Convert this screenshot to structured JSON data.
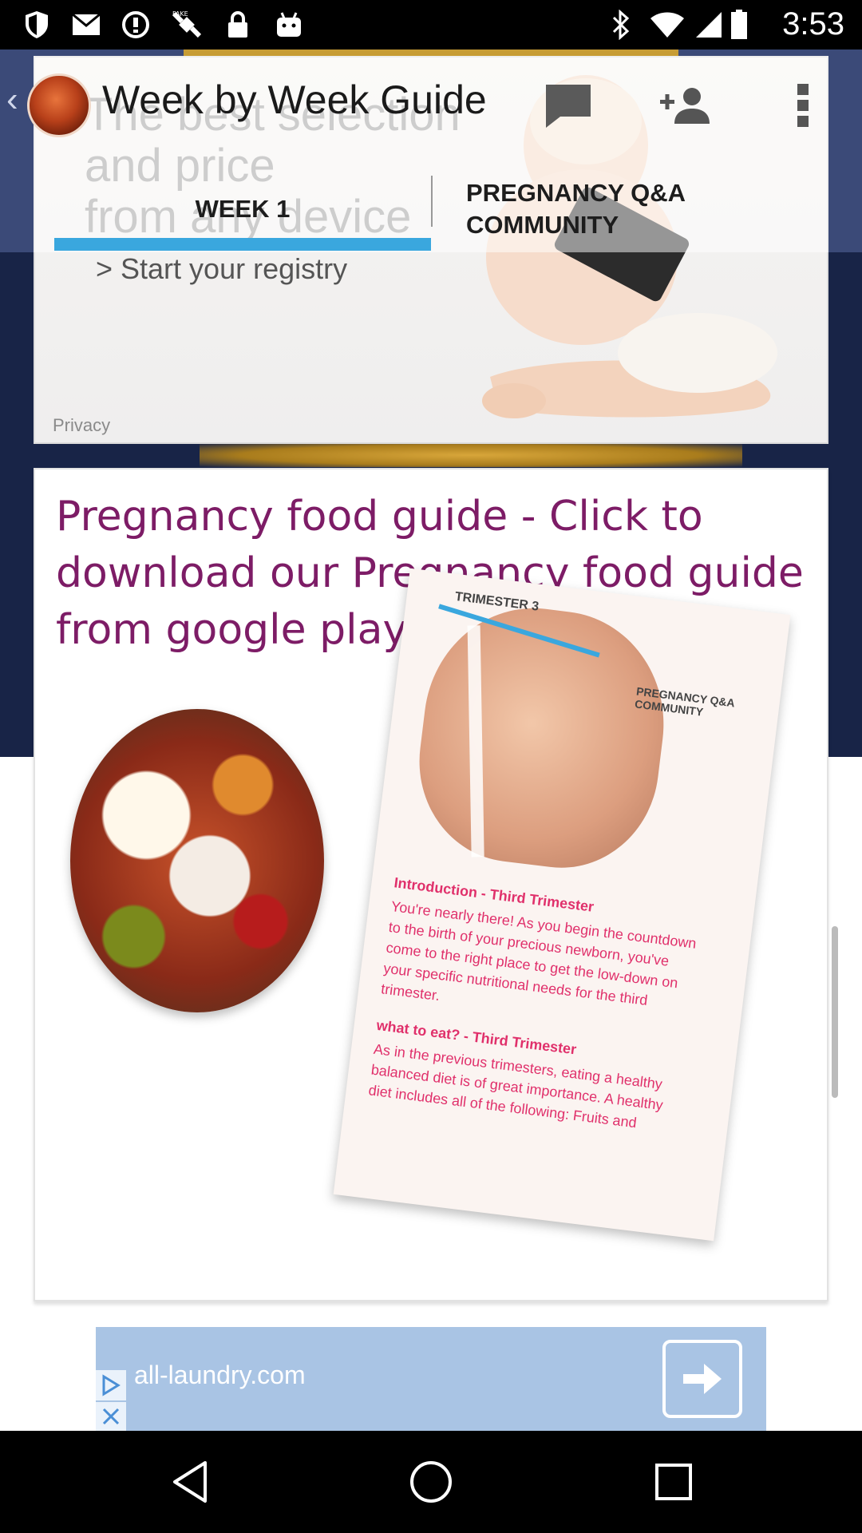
{
  "status_bar": {
    "time": "3:53",
    "icons": [
      "shield-icon",
      "mail-icon",
      "data-saver-icon",
      "fake-gps-icon",
      "lock-icon",
      "android-icon",
      "bluetooth-icon",
      "wifi-icon",
      "signal-icon",
      "battery-icon"
    ]
  },
  "ad_card": {
    "line1": "The best selection",
    "line2": "and price",
    "line3": "from any device",
    "link": "> Start your registry",
    "privacy": "Privacy"
  },
  "toolbar": {
    "title": "Week by Week Guide",
    "chat_icon": "chat-icon",
    "add_person_icon": "add-person-icon",
    "more_icon": "more-vert-icon"
  },
  "tabs": [
    {
      "label": "WEEK 1",
      "selected": true
    },
    {
      "label": "PREGNANCY Q&A\nCOMMUNITY",
      "selected": false
    }
  ],
  "promo": {
    "headline": "Pregnancy food guide - Click to download our Pregnancy food guide from google play store",
    "doc": {
      "trimester_label": "TRIMESTER 3",
      "qa_label": "PREGNANCY Q&A\nCOMMUNITY",
      "intro_heading": "Introduction - Third Trimester",
      "intro_body": "You're nearly there! As you begin the countdown\nto the birth of your precious newborn, you've\ncome to the right place to get the low-down on\nyour specific nutritional needs for the third\ntrimester.",
      "eat_heading": "what to eat? - Third Trimester",
      "eat_body": "As in the previous trimesters, eating a healthy\nbalanced diet is of great importance. A healthy\ndiet includes all of the following: Fruits and"
    }
  },
  "banner_ad": {
    "domain": "all-laundry.com",
    "arrow_icon": "arrow-right-icon",
    "ad_choices_icon": "ad-choices-icon",
    "close_icon": "close-icon"
  },
  "nav_bar": {
    "back": "back-icon",
    "home": "home-icon",
    "recents": "recents-icon"
  },
  "colors": {
    "accent_tab": "#3aa7de",
    "promo_text": "#7d1c66",
    "background_dark": "#182447",
    "banner_bg": "#a9c4e4"
  }
}
